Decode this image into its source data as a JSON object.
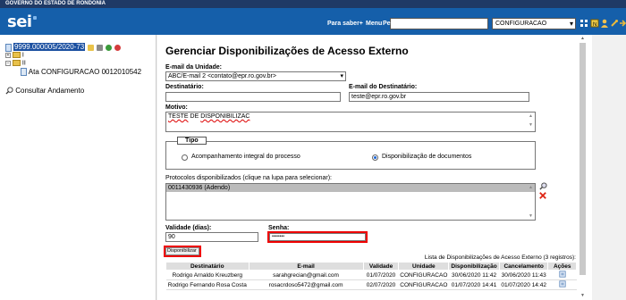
{
  "gov_bar": {
    "text": "GOVERNO DO ESTADO DE RONDÔNIA"
  },
  "header": {
    "logo": "sei",
    "links": {
      "para_saber": "Para saber+",
      "menu": "Menu",
      "pesquisa": "Pesquisa"
    },
    "unit_selected": "CONFIGURACAO",
    "icons": [
      "grid-icon",
      "notepad-icon",
      "user-icon",
      "tools-icon",
      "logout-icon"
    ]
  },
  "tree": {
    "process_number": "9999.000005/2020-73",
    "folders": [
      "I",
      "II"
    ],
    "document": "Ata CONFIGURACAO 0012010542",
    "consultar": "Consultar Andamento"
  },
  "form": {
    "title": "Gerenciar Disponibilizações de Acesso Externo",
    "email_unit_label": "E-mail da Unidade:",
    "email_unit_value": "ABC/E-mail 2 <contato@epr.ro.gov.br>",
    "destinatario_label": "Destinatário:",
    "destinatario_value": "",
    "email_dest_label": "E-mail do Destinatário:",
    "email_dest_value": "teste@epr.ro.gov.br",
    "motivo_label": "Motivo:",
    "motivo_value_1": "TESTE",
    "motivo_value_2": "DE",
    "motivo_value_3": "DISPONIBILIZAC",
    "tipo_legend": "Tipo",
    "tipo_options": [
      "Acompanhamento integral do processo",
      "Disponibilização de documentos"
    ],
    "tipo_selected_index": 1,
    "protocolos_label": "Protocolos disponibilizados (clique na lupa para selecionar):",
    "protocolos_items": [
      "0011430936 (Adendo)"
    ],
    "validade_label": "Validade (dias):",
    "validade_value": "90",
    "senha_label": "Senha:",
    "senha_value": "••••••••",
    "submit_label": "Disponibilizar"
  },
  "table": {
    "caption": "Lista de Disponibilizações de Acesso Externo (3 registros):",
    "headers": [
      "Destinatário",
      "E-mail",
      "Validade",
      "Unidade",
      "Disponibilização",
      "Cancelamento",
      "Ações"
    ],
    "rows": [
      [
        "Rodrigo Arnaldo Kreuzberg",
        "sarahgrecian@gmail.com",
        "01/07/2020",
        "CONFIGURACAO",
        "30/06/2020 11:42",
        "30/06/2020 11:43"
      ],
      [
        "Rodrigo Fernando Rosa Costa",
        "rosacrdoso5472@gmail.com",
        "02/07/2020",
        "CONFIGURACAO",
        "01/07/2020 14:41",
        "01/07/2020 14:42"
      ]
    ]
  },
  "colors": {
    "header_blue": "#155faa",
    "gov_bar": "#1f3a66",
    "highlight_red": "#ee0000"
  }
}
